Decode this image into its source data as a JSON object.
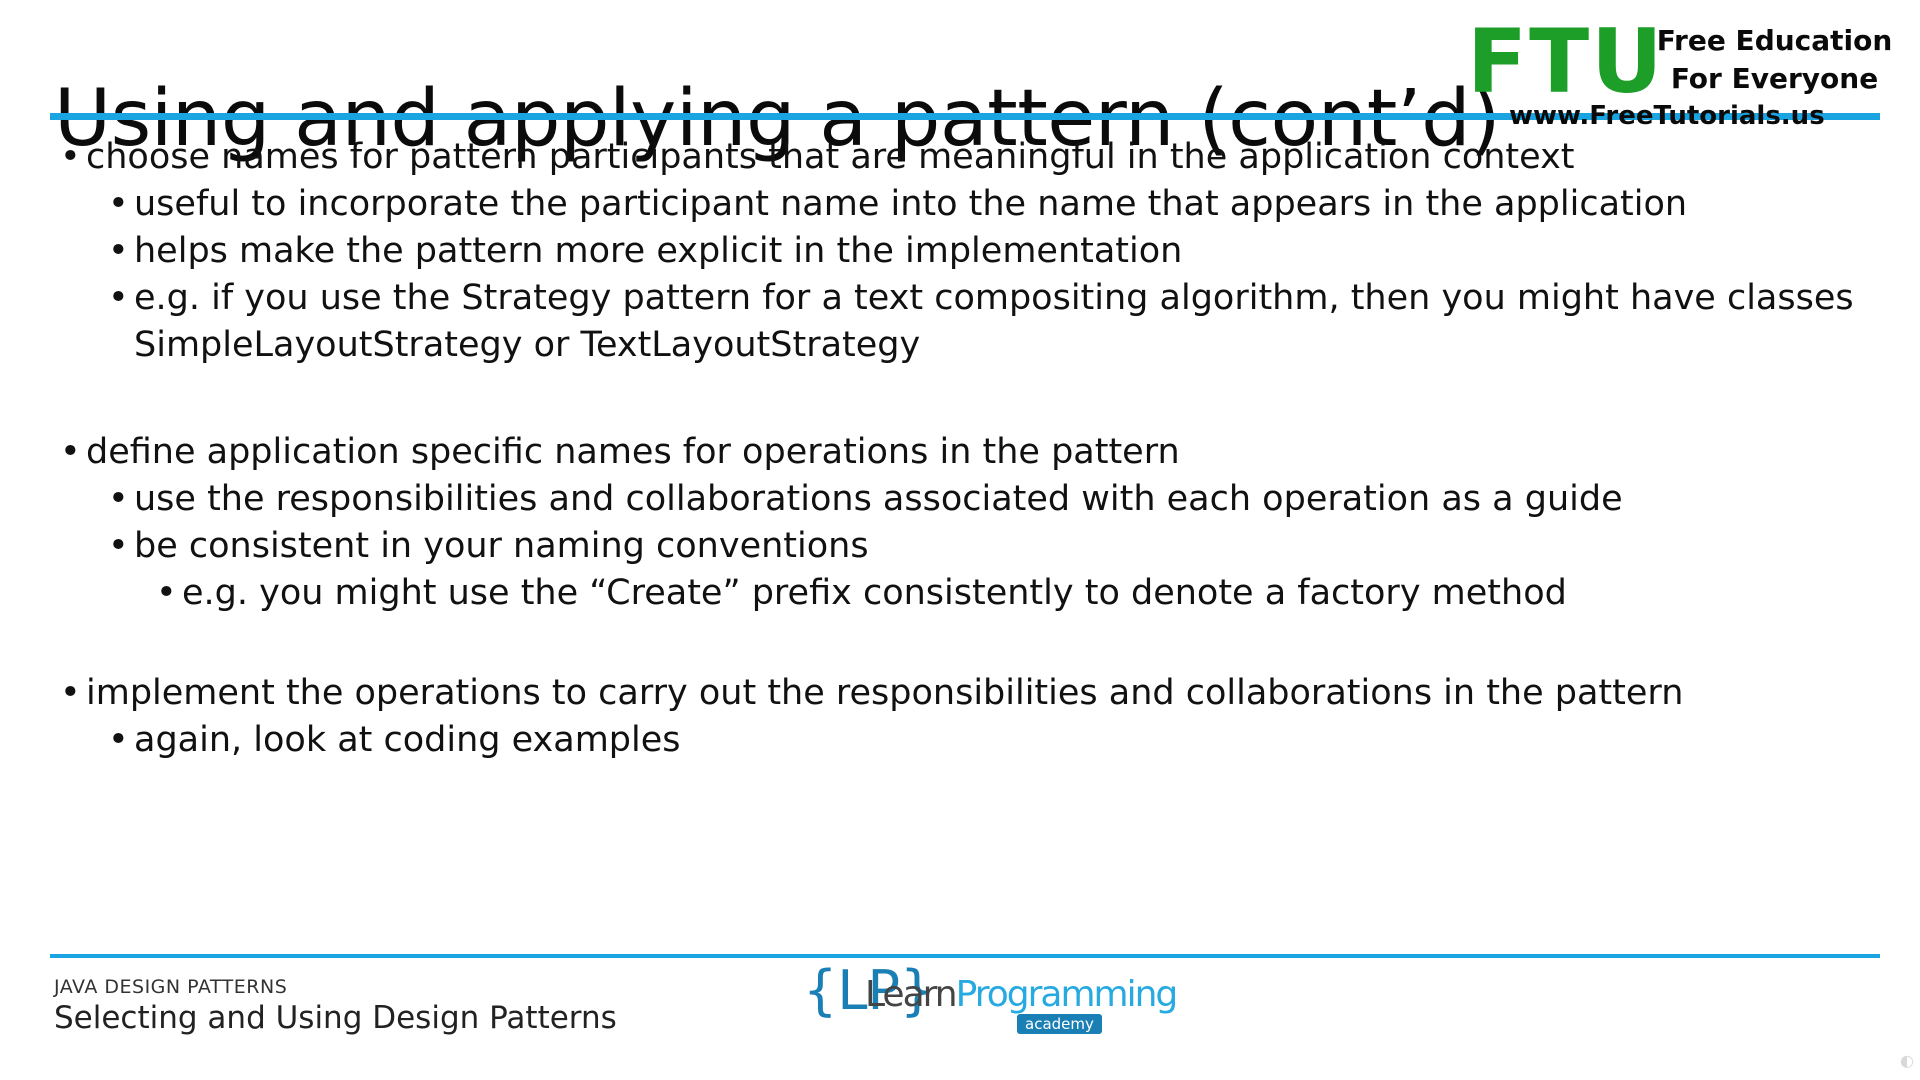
{
  "slide": {
    "title": "Using and applying a pattern (cont’d)"
  },
  "branding": {
    "ftu_logo": "FTU",
    "ftu_tagline_line1": "Free Education",
    "ftu_tagline_line2": "For Everyone",
    "ftu_url": "www.FreeTutorials.us"
  },
  "bullets": {
    "b1": "choose names for pattern participants that are meaningful in the application context",
    "b1_1": "useful to incorporate the participant name into the name that appears in the application",
    "b1_2": "helps make the pattern more explicit in the implementation",
    "b1_3": "e.g.  if you use the Strategy pattern for a text compositing algorithm, then you might have classes SimpleLayoutStrategy or TextLayoutStrategy",
    "b2": "define application specific names for operations in the pattern",
    "b2_1": "use the responsibilities and collaborations associated with each operation as a guide",
    "b2_2": "be consistent in your naming conventions",
    "b2_2_1": "e.g.  you might use the “Create” prefix consistently to denote a factory method",
    "b3": "implement the operations to carry out the responsibilities and collaborations in the pattern",
    "b3_1": "again, look at coding examples"
  },
  "footer": {
    "course": "JAVA DESIGN PATTERNS",
    "section": "Selecting and Using Design Patterns",
    "logo_brace": "{LP}",
    "logo_learn": "Learn",
    "logo_programming": "Programming",
    "logo_academy": "academy"
  },
  "colors": {
    "accent": "#1aa4e2",
    "ftu_green": "#1d9e28"
  }
}
